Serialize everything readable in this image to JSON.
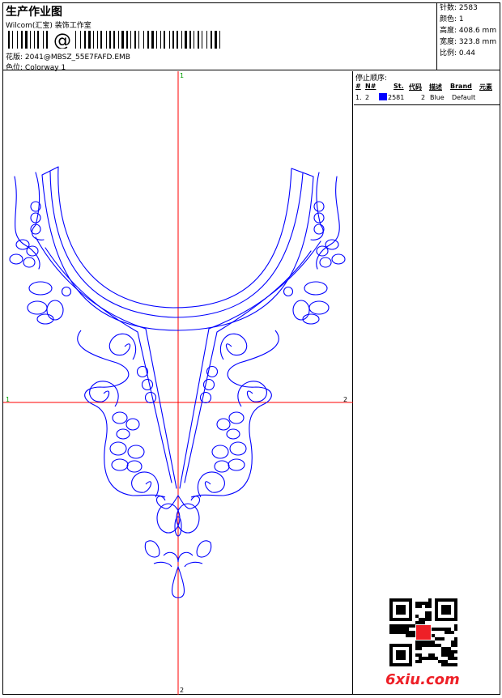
{
  "header": {
    "title": "生产作业图",
    "company": "Wilcom(汇宝) 装饰工作室",
    "barcode_text": "@",
    "pattern_label": "花版:",
    "pattern_file": "2041@MBSZ_55E7FAFD.EMB",
    "colorway_label": "色位:",
    "colorway": "Colorway 1"
  },
  "stats": {
    "stitches_label": "针数:",
    "stitches": "2583",
    "colors_label": "颜色:",
    "colors": "1",
    "height_label": "高度:",
    "height": "408.6 mm",
    "width_label": "宽度:",
    "width": "323.8 mm",
    "scale_label": "比例:",
    "scale": "0.44"
  },
  "stop_sequence": {
    "label": "停止顺序:",
    "columns": [
      "#",
      "N#",
      "St.",
      "代码",
      "描述",
      "Brand",
      "元素"
    ],
    "rows": [
      {
        "index": "1.",
        "needle": "2",
        "stitches": "2581",
        "code": "2",
        "description": "Blue",
        "brand": "Default",
        "color": "#0000ff"
      }
    ]
  },
  "markers": {
    "top": "1",
    "bottom": "2",
    "left": "1",
    "right": "2"
  },
  "colors": {
    "thread": "#0000ff",
    "crosshair": "#ff0000",
    "logo": "#ee2027"
  },
  "watermark": {
    "text": "6xiu.com"
  }
}
